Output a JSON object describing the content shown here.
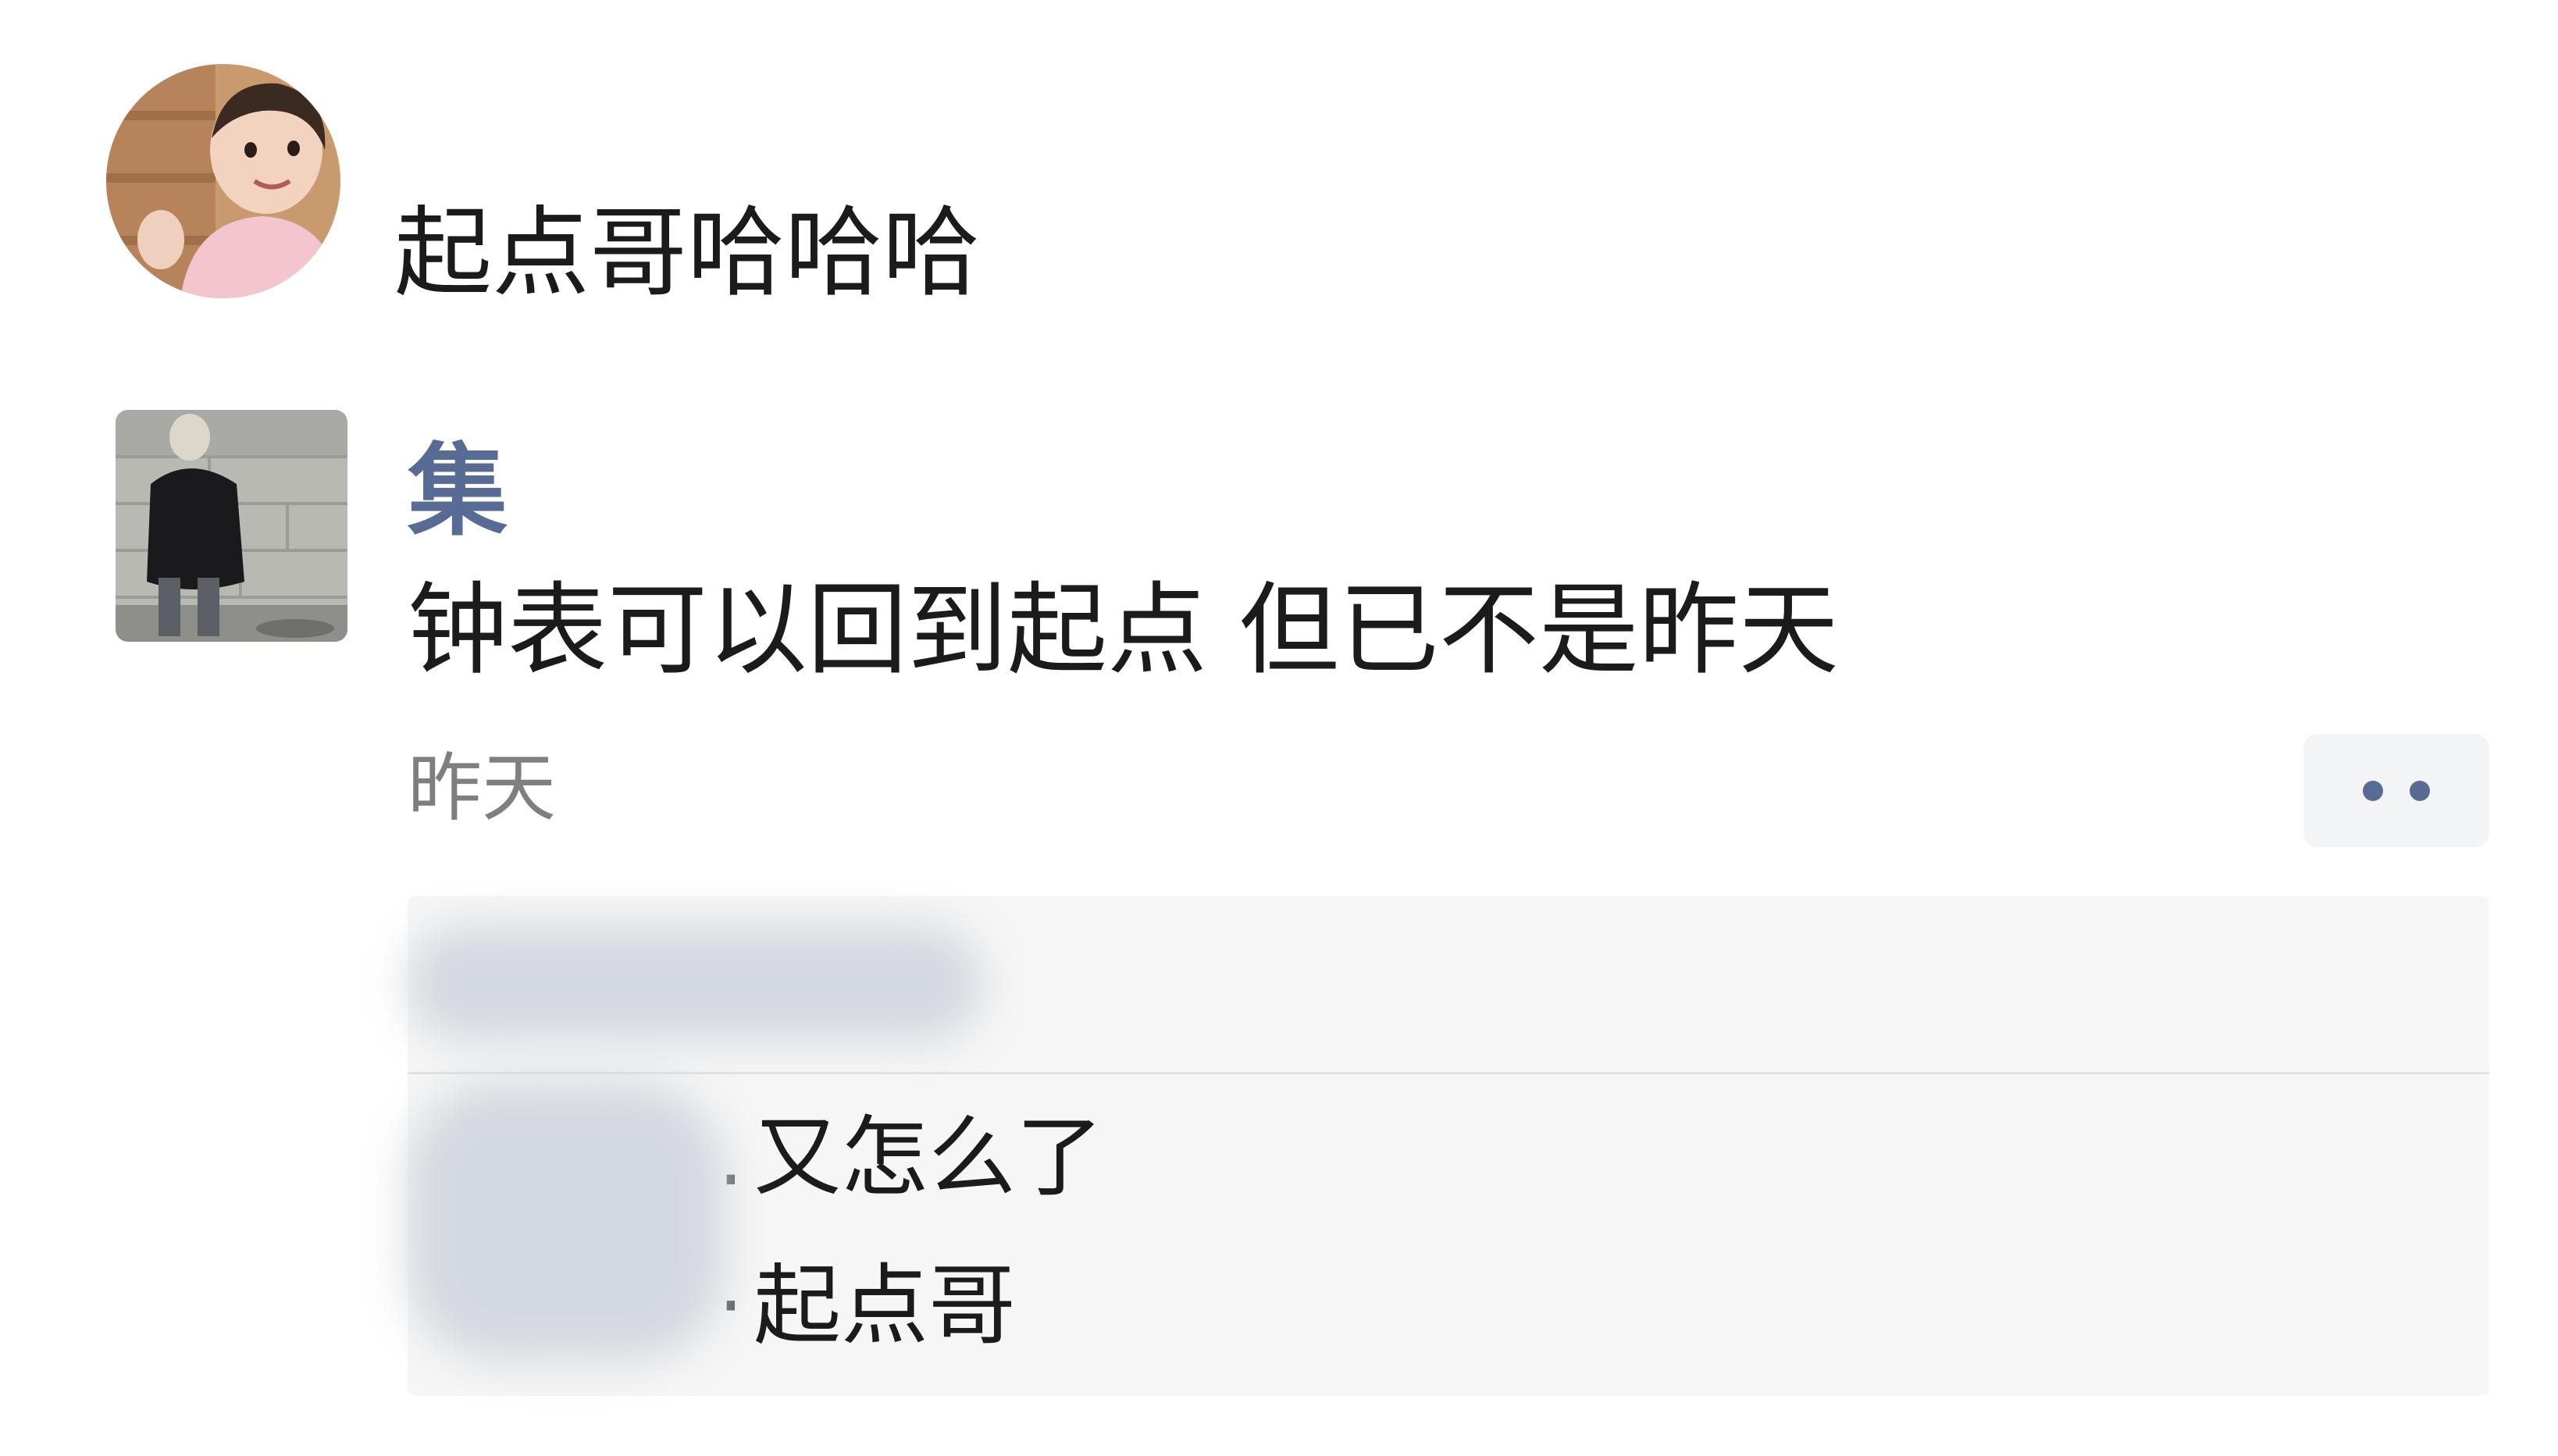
{
  "top_message": {
    "text": "起点哥哈哈哈"
  },
  "post": {
    "author": "集",
    "text": "钟表可以回到起点 但已不是昨天",
    "time": "昨天"
  },
  "comments": [
    {
      "separator": ".",
      "text": "又怎么了"
    },
    {
      "separator": "·",
      "text": "起点哥"
    }
  ],
  "colors": {
    "name_link": "#576b95",
    "panel_background": "#f6f6f6",
    "time_text": "#7f7f7f"
  },
  "icons": {
    "more": "two-dots-icon"
  }
}
